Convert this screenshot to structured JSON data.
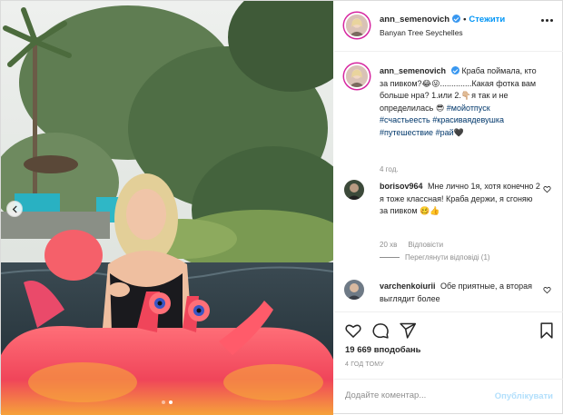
{
  "header": {
    "username": "ann_semenovich",
    "separator": "•",
    "follow_label": "Стежити",
    "location": "Banyan Tree Seychelles"
  },
  "caption": {
    "username": "ann_semenovich",
    "text": "Краба поймала, кто за пивком?😂😜..............Какая фотка вам больше нра? 1.или 2.👇🏼я так и не определилась 😎",
    "hashtags": [
      "#мойотпуск",
      "#счастьеесть",
      "#красиваядевушка",
      "#путешествие",
      "#рай🖤"
    ],
    "time": "4 год."
  },
  "comments": [
    {
      "username": "borisov964",
      "text": "Мне лично 1я, хотя конечно 2 я тоже классная! Краба держи, я сгоняю за пивком 🥴👍",
      "time": "20 хв",
      "reply_label": "Відповісти",
      "view_replies_label": "Переглянути відповіді (1)"
    },
    {
      "username": "varchenkoiurii",
      "text": "Обе приятные, а вторая выглядит более"
    }
  ],
  "likes": "19 669 вподобань",
  "timestamp": "4 ГОД ТОМУ",
  "comment_input": {
    "placeholder": "Додайте коментар..."
  },
  "publish_label": "Опублікувати",
  "icons": {
    "verified": "verified-badge-icon",
    "more": "more-options-icon",
    "like": "heart-icon",
    "comment": "comment-icon",
    "share": "send-icon",
    "save": "bookmark-icon",
    "prev": "chevron-left-icon"
  },
  "carousel": {
    "slides": 2,
    "active": 1
  },
  "colors": {
    "link": "#0095f6",
    "hashtag": "#00376b",
    "muted": "#8e8e8e",
    "verified": "#3897f0",
    "float": "#f0455a"
  }
}
